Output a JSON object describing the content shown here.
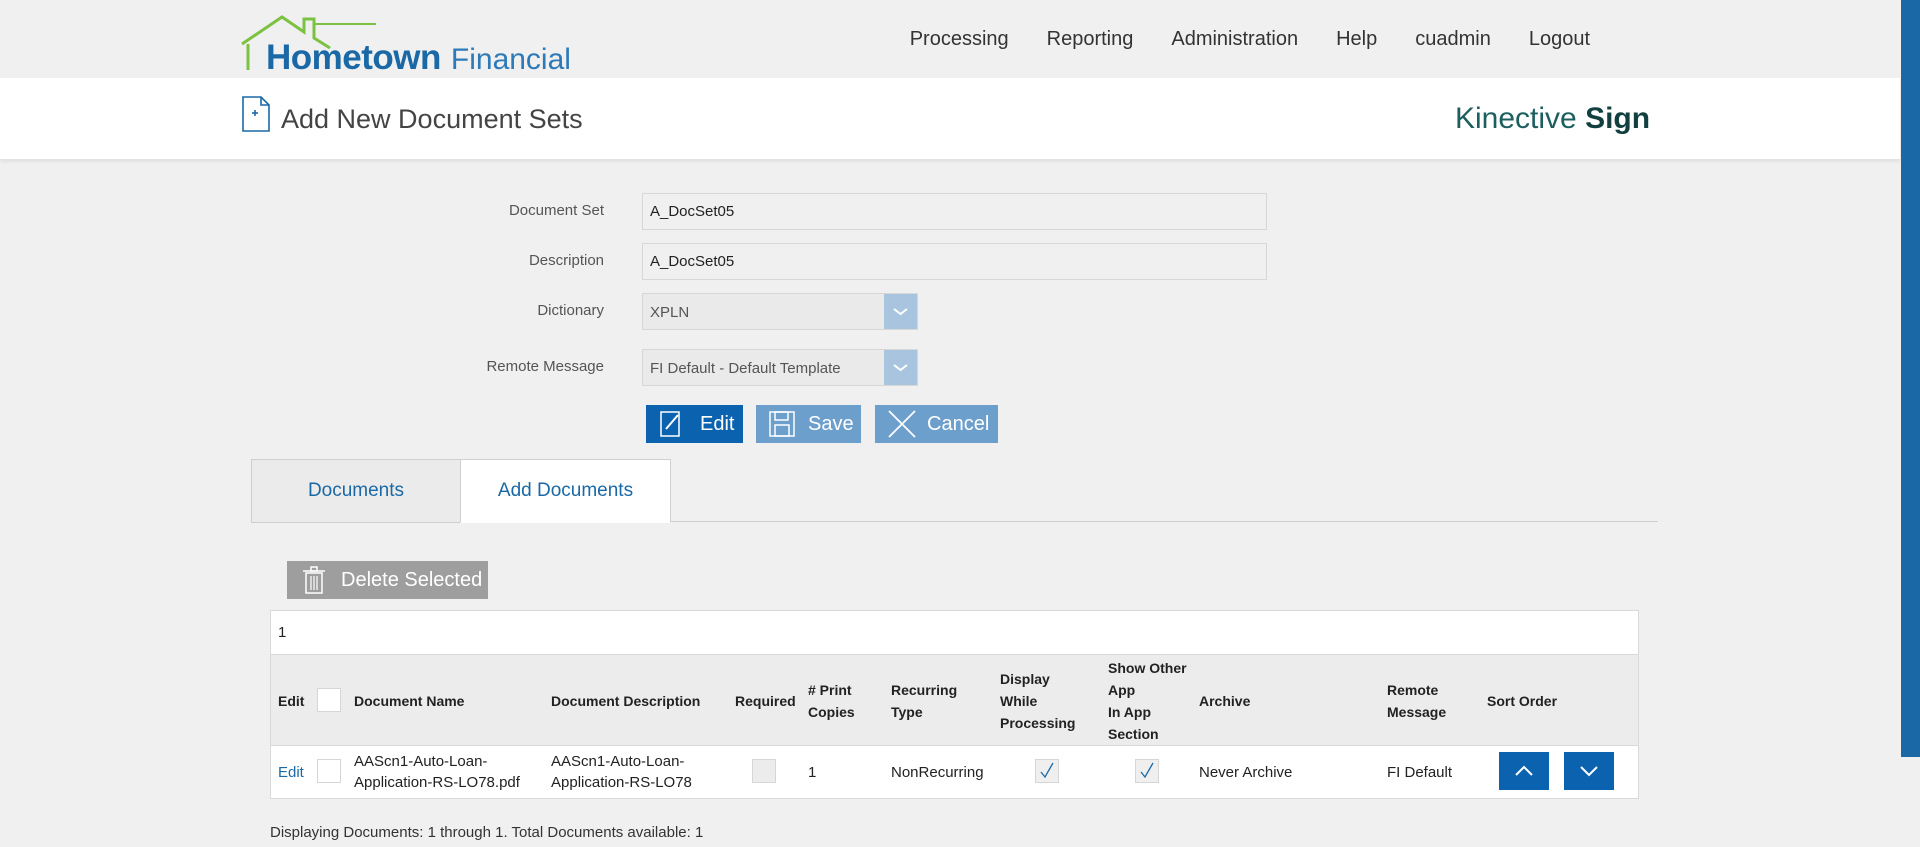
{
  "header": {
    "logo_main": "Hometown",
    "logo_sub": "Financial",
    "nav": [
      "Processing",
      "Reporting",
      "Administration",
      "Help",
      "cuadmin",
      "Logout"
    ]
  },
  "title": {
    "page_title": "Add New Document Sets",
    "brand_light": "Kinective",
    "brand_bold": "Sign"
  },
  "form": {
    "document_set_label": "Document Set",
    "document_set_value": "A_DocSet05",
    "description_label": "Description",
    "description_value": "A_DocSet05",
    "dictionary_label": "Dictionary",
    "dictionary_value": "XPLN",
    "remote_message_label": "Remote Message",
    "remote_message_value": "FI Default - Default Template"
  },
  "actions": {
    "edit": "Edit",
    "save": "Save",
    "cancel": "Cancel"
  },
  "tabs": {
    "documents": "Documents",
    "add_documents": "Add Documents"
  },
  "grid": {
    "delete_selected": "Delete Selected",
    "pager": "1",
    "headers": {
      "edit": "Edit",
      "document_name": "Document Name",
      "document_description": "Document Description",
      "required": "Required",
      "print_copies_1": "# Print",
      "print_copies_2": "Copies",
      "recurring_1": "Recurring",
      "recurring_2": "Type",
      "display_1": "Display",
      "display_2": "While",
      "display_3": "Processing",
      "show_1": "Show Other",
      "show_2": "App",
      "show_3": "In App",
      "show_4": "Section",
      "archive": "Archive",
      "remote_1": "Remote",
      "remote_2": "Message",
      "sort_order": "Sort Order"
    },
    "rows": [
      {
        "edit": "Edit",
        "name_1": "AAScn1-Auto-Loan-",
        "name_2": "Application-RS-LO78.pdf",
        "desc_1": "AAScn1-Auto-Loan-",
        "desc_2": "Application-RS-LO78",
        "copies": "1",
        "recurring": "NonRecurring",
        "archive": "Never Archive",
        "remote": "FI Default"
      }
    ],
    "footer": "Displaying Documents: 1 through 1. Total Documents available: 1"
  },
  "colors": {
    "primary": "#0b63b0",
    "muted": "#6d9fcc",
    "logo_green": "#7cc242"
  }
}
